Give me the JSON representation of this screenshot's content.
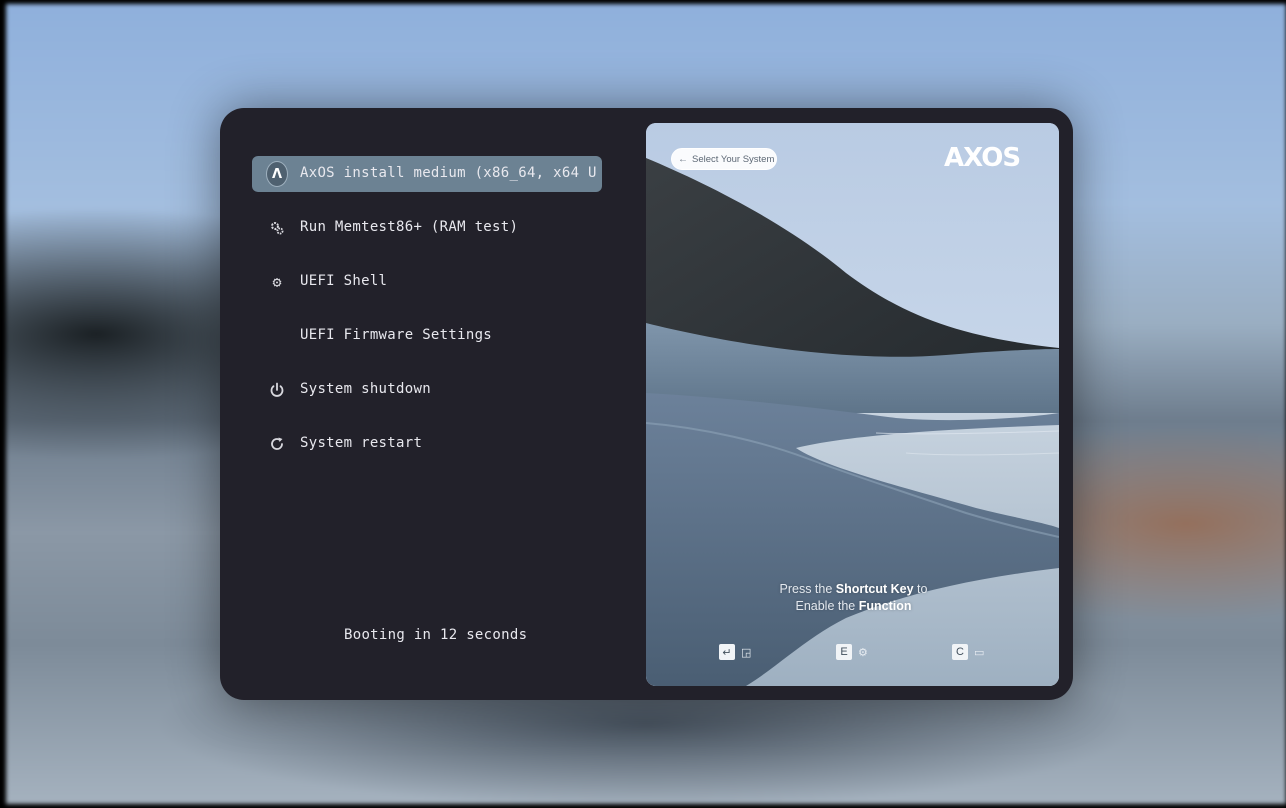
{
  "menu": {
    "items": [
      {
        "label": "AxOS install medium (x86_64, x64 UEF",
        "icon": "axos-logo-icon",
        "selected": true
      },
      {
        "label": "Run Memtest86+ (RAM test)",
        "icon": "gears-icon",
        "selected": false
      },
      {
        "label": "UEFI Shell",
        "icon": "gear-icon",
        "selected": false
      },
      {
        "label": "UEFI Firmware Settings",
        "icon": "",
        "selected": false
      },
      {
        "label": "System shutdown",
        "icon": "power-icon",
        "selected": false
      },
      {
        "label": "System restart",
        "icon": "restart-icon",
        "selected": false
      }
    ],
    "logo_letter": "Λ"
  },
  "status": {
    "booting": "Booting in 12 seconds"
  },
  "preview": {
    "select_label": "Select Your System",
    "brand": "AXOS",
    "hint": {
      "line1_pre": "Press the ",
      "line1_bold": "Shortcut Key",
      "line1_post": " to",
      "line2_pre": "Enable the ",
      "line2_bold": "Function"
    },
    "shortcuts": [
      {
        "key": "↵",
        "icon": "boot-icon"
      },
      {
        "key": "E",
        "icon": "settings-icon"
      },
      {
        "key": "C",
        "icon": "terminal-icon"
      }
    ]
  },
  "colors": {
    "panel": "#22212a",
    "selected": "#6c8293",
    "text": "#e8e8ee"
  }
}
